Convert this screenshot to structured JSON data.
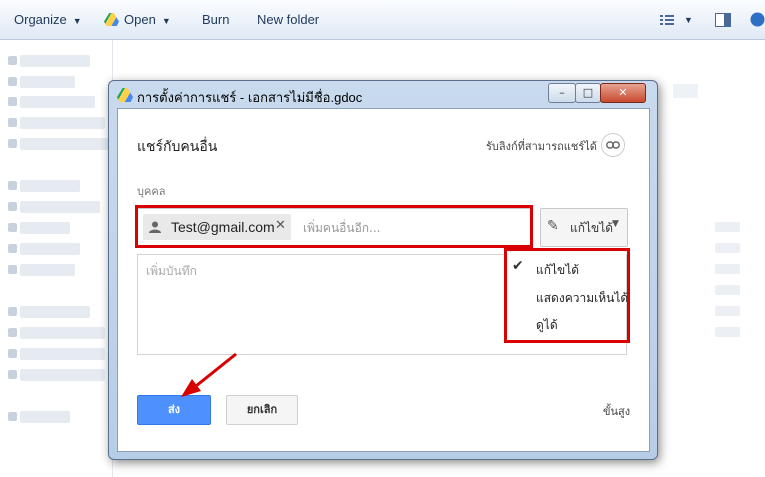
{
  "explorer": {
    "toolbar": {
      "organize": "Organize",
      "open": "Open",
      "burn": "Burn",
      "new_folder": "New folder"
    }
  },
  "dialog": {
    "title": "การตั้งค่าการแชร์ - เอกสารไม่มีชื่อ.gdoc",
    "window_buttons": {
      "minimize": "–",
      "maximize": "□",
      "close": "✕"
    },
    "heading": "แชร์กับคนอื่น",
    "link_label": "รับลิงก์ที่สามารถแชร์ได้",
    "people_label": "บุคคล",
    "chip_email": "Test@gmail.com",
    "chip_remove": "✕",
    "add_more_placeholder": "เพิ่มคนอื่นอีก...",
    "permission_label": "แก้ไขได้",
    "note_placeholder": "เพิ่มบันทึก",
    "dropdown": {
      "items": [
        "แก้ไขได้",
        "แสดงความเห็นได้",
        "ดูได้"
      ],
      "checked_index": 0
    },
    "send_label": "ส่ง",
    "cancel_label": "ยกเลิก",
    "advanced_label": "ขั้นสูง"
  },
  "colors": {
    "send_blue": "#4d90fe",
    "highlight_red": "#d80000",
    "explorer_toolbar": "#dfe9f5",
    "dialog_frame": "#b7cde6"
  }
}
